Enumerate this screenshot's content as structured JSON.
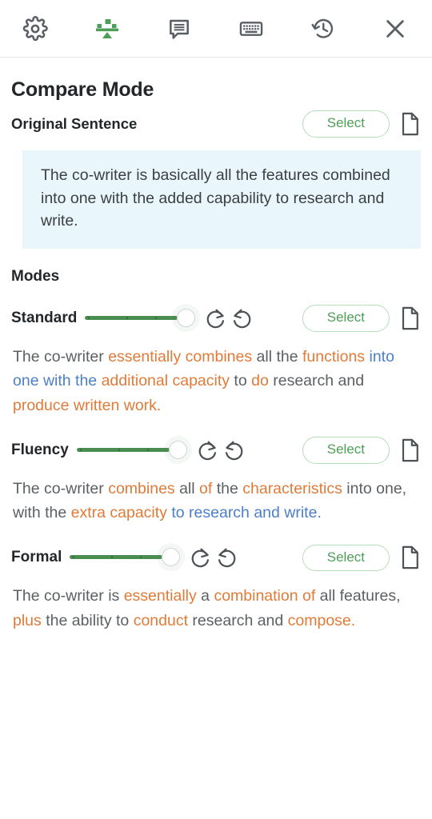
{
  "toolbar": {
    "items": [
      {
        "name": "settings-icon",
        "label": "Settings"
      },
      {
        "name": "compare-icon",
        "label": "Compare"
      },
      {
        "name": "comment-icon",
        "label": "Comments"
      },
      {
        "name": "keyboard-icon",
        "label": "Keyboard"
      },
      {
        "name": "history-icon",
        "label": "History"
      },
      {
        "name": "close-icon",
        "label": "Close"
      }
    ]
  },
  "header": {
    "title": "Compare Mode",
    "original_label": "Original Sentence",
    "select_label": "Select"
  },
  "original": {
    "text": "The co-writer is basically all the features combined into one with the added capability to research and write."
  },
  "modes_heading": "Modes",
  "modes": [
    {
      "name": "Standard",
      "select_label": "Select",
      "slider_value": 100,
      "output_segments": [
        {
          "text": "The co-writer ",
          "type": "same"
        },
        {
          "text": "essentially combines",
          "type": "changed"
        },
        {
          "text": " all the ",
          "type": "same"
        },
        {
          "text": "functions",
          "type": "changed"
        },
        {
          "text": " ",
          "type": "same"
        },
        {
          "text": "into one with the",
          "type": "moved"
        },
        {
          "text": " ",
          "type": "same"
        },
        {
          "text": "additional capacity",
          "type": "changed"
        },
        {
          "text": " to ",
          "type": "same"
        },
        {
          "text": "do",
          "type": "changed"
        },
        {
          "text": " research and ",
          "type": "same"
        },
        {
          "text": "produce written work.",
          "type": "changed"
        }
      ]
    },
    {
      "name": "Fluency",
      "select_label": "Select",
      "slider_value": 100,
      "output_segments": [
        {
          "text": "The co-writer ",
          "type": "same"
        },
        {
          "text": "combines",
          "type": "changed"
        },
        {
          "text": " all ",
          "type": "same"
        },
        {
          "text": "of",
          "type": "changed"
        },
        {
          "text": " the ",
          "type": "same"
        },
        {
          "text": "characteristics",
          "type": "changed"
        },
        {
          "text": " into one, with the ",
          "type": "same"
        },
        {
          "text": "extra capacity",
          "type": "changed"
        },
        {
          "text": " ",
          "type": "same"
        },
        {
          "text": "to research and write.",
          "type": "moved"
        }
      ]
    },
    {
      "name": "Formal",
      "select_label": "Select",
      "slider_value": 100,
      "output_segments": [
        {
          "text": "The co-writer is ",
          "type": "same"
        },
        {
          "text": "essentially",
          "type": "changed"
        },
        {
          "text": " a ",
          "type": "same"
        },
        {
          "text": "combination of",
          "type": "changed"
        },
        {
          "text": " all features, ",
          "type": "same"
        },
        {
          "text": "plus",
          "type": "changed"
        },
        {
          "text": " the ability to ",
          "type": "same"
        },
        {
          "text": "conduct",
          "type": "changed"
        },
        {
          "text": " research and ",
          "type": "same"
        },
        {
          "text": "compose.",
          "type": "changed"
        }
      ]
    }
  ],
  "colors": {
    "changed": "#e07b39",
    "moved": "#4c7fc8",
    "accent_green": "#4a8d50",
    "select_green": "#4f9e58",
    "original_bg": "#e9f6fb",
    "icon_gray": "#5a5f63"
  }
}
